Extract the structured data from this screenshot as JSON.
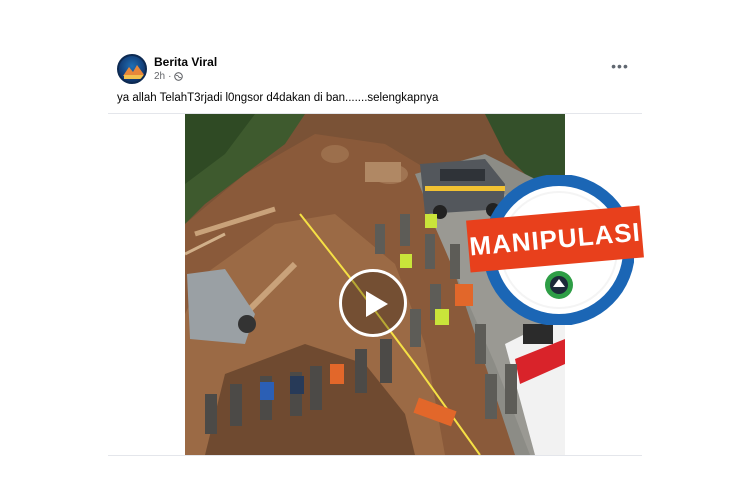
{
  "post": {
    "page_name": "Berita Viral",
    "time": "2h",
    "audience_icon": "globe-icon",
    "more_icon": "more-options-icon",
    "caption": "ya allah TelahT3rjadi l0ngsor d4dakan di ban.......selengkapnya"
  },
  "media": {
    "type": "video",
    "play_icon": "play-icon"
  },
  "stamp": {
    "label": "MANIPULASI",
    "colors": {
      "ring": "#1b66b5",
      "label_bg": "#e8401c",
      "seal": "#2e9e46"
    }
  }
}
